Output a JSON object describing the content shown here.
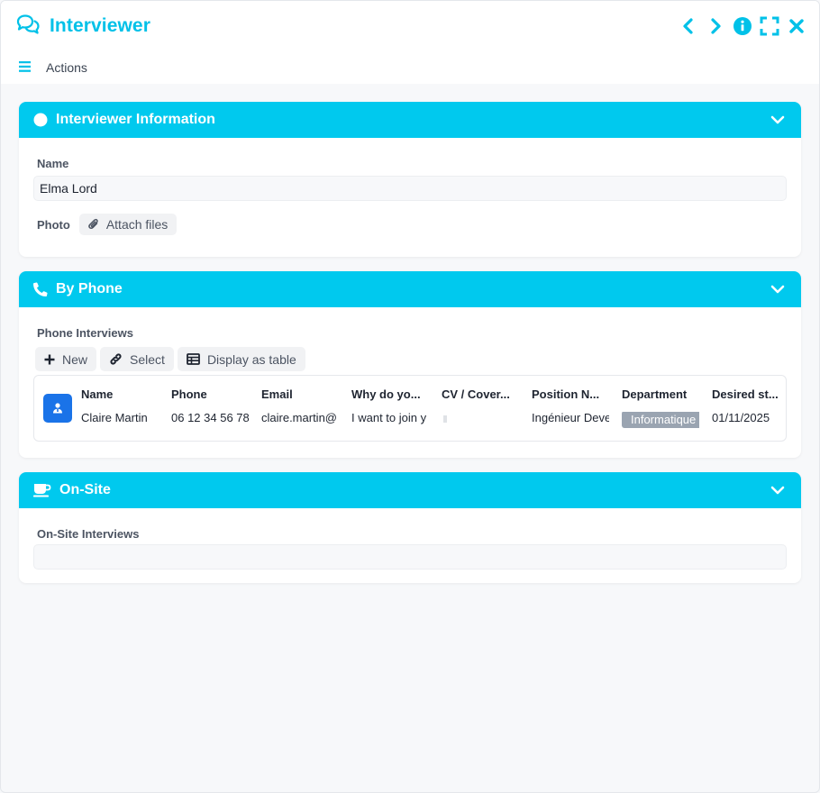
{
  "window": {
    "title": "Interviewer",
    "accent_color": "#00c1e8",
    "header_color": "#00c9ee"
  },
  "actionbar": {
    "label": "Actions"
  },
  "sections": {
    "info": {
      "title": "Interviewer Information",
      "name_label": "Name",
      "name_value": "Elma Lord",
      "photo_label": "Photo",
      "attach_label": "Attach files"
    },
    "phone": {
      "title": "By Phone",
      "subtitle": "Phone Interviews",
      "toolbar": {
        "new_label": "New",
        "select_label": "Select",
        "table_label": "Display as table"
      },
      "columns": [
        "Name",
        "Phone",
        "Email",
        "Why do yo...",
        "CV / Cover...",
        "Position N...",
        "Department",
        "Desired st..."
      ],
      "row": {
        "name": "Claire Martin",
        "phone": "06 12 34 56 78",
        "email": "claire.martin@",
        "why": "I want to join y",
        "cv": "",
        "position": "Ingénieur Deve",
        "department": "Informatique",
        "desired_start": "01/11/2025"
      }
    },
    "onsite": {
      "title": "On-Site",
      "subtitle": "On-Site Interviews"
    }
  }
}
